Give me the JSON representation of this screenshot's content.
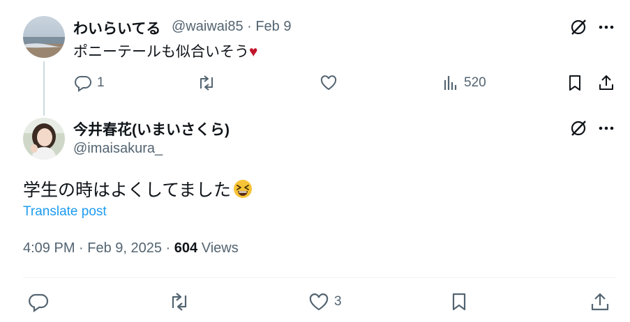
{
  "reply": {
    "name": "わいらいてる",
    "handle_date": "@waiwai85 · Feb 9",
    "text": "ポニーテールも似合いそう",
    "emoji": "♥",
    "reply_count": "1",
    "views": "520"
  },
  "main": {
    "name": "今井春花(いまいさくら)",
    "handle": "@imaisakura_",
    "text": "学生の時はよくしてました",
    "translate_label": "Translate post",
    "time": "4:09 PM · Feb 9, 2025 · ",
    "views_count": "604",
    "views_label": " Views",
    "like_count": "3"
  },
  "icons": [
    "grok-icon",
    "more-icon",
    "reply-icon",
    "retweet-icon",
    "like-icon",
    "views-icon",
    "bookmark-icon",
    "share-icon"
  ],
  "colors": {
    "text": "#0f1419",
    "muted": "#536471",
    "link": "#1d9bf0",
    "heart": "#c0152a"
  }
}
